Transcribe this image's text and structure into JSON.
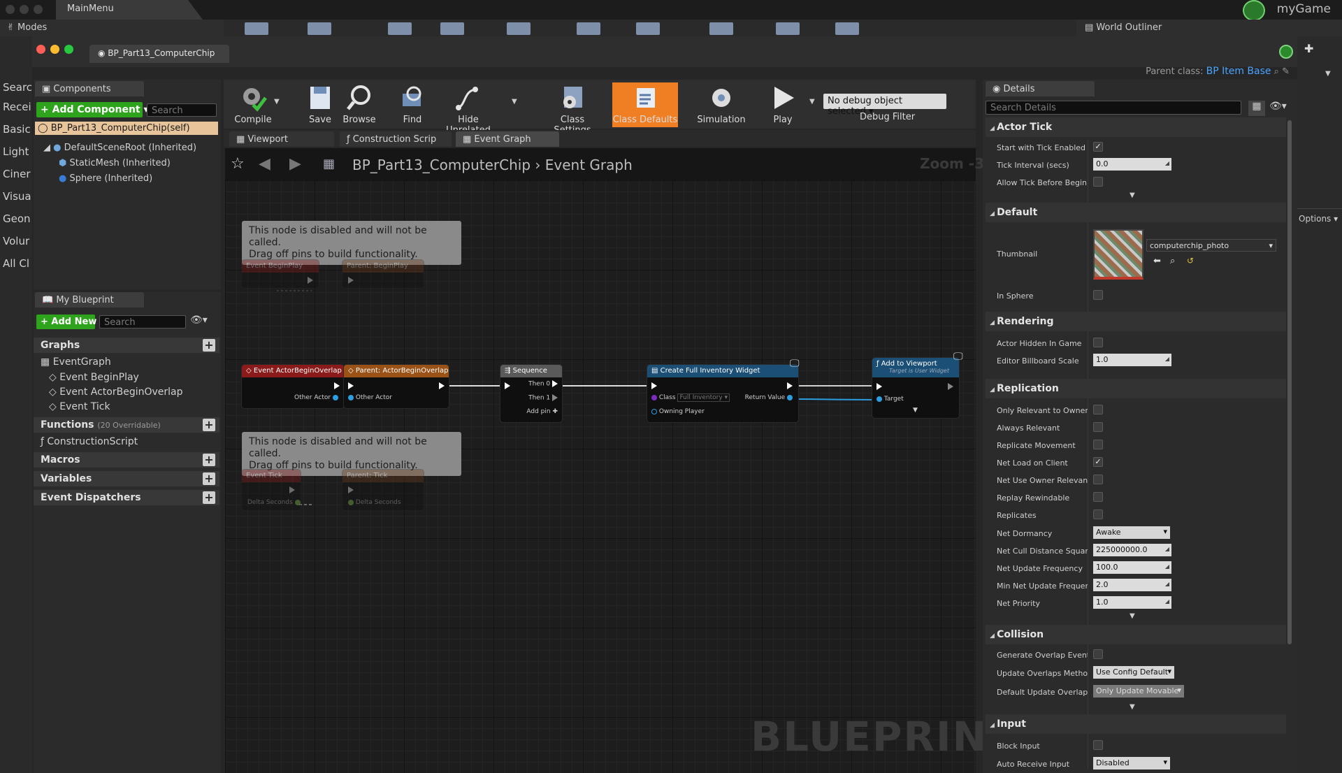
{
  "window": {
    "main_tab": "MainMenu",
    "app_name": "myGame",
    "modes_label": "Modes",
    "world_outliner": "World Outliner"
  },
  "left_strip": [
    "Searc",
    "Recei",
    "Basic",
    "Light",
    "Ciner",
    "Visua",
    "Geon",
    "Volur",
    "All Cl"
  ],
  "blueprint_tab": "BP_Part13_ComputerChip",
  "parent_class": {
    "label": "Parent class:",
    "value": "BP Item Base"
  },
  "components": {
    "tab": "Components",
    "add_label": "+ Add Component ▾",
    "search_placeholder": "Search",
    "items": [
      {
        "label": "BP_Part13_ComputerChip(self)",
        "selected": true
      },
      {
        "label": "DefaultSceneRoot (Inherited)"
      },
      {
        "label": "StaticMesh (Inherited)"
      },
      {
        "label": "Sphere (Inherited)"
      }
    ]
  },
  "my_blueprint": {
    "tab": "My Blueprint",
    "add_label": "+ Add New ▾",
    "search_placeholder": "Search",
    "graphs_label": "Graphs",
    "event_graph": "EventGraph",
    "events": [
      "Event BeginPlay",
      "Event ActorBeginOverlap",
      "Event Tick"
    ],
    "functions_label": "Functions",
    "functions_note": "(20 Overridable)",
    "construction_script": "ConstructionScript",
    "macros": "Macros",
    "variables": "Variables",
    "dispatchers": "Event Dispatchers"
  },
  "toolbar": {
    "buttons": [
      "Compile",
      "Save",
      "Browse",
      "Find",
      "Hide Unrelated",
      "Class Settings",
      "Class Defaults",
      "Simulation",
      "Play"
    ],
    "active": "Class Defaults",
    "debug_select": "No debug object selected ▾",
    "debug_filter": "Debug Filter"
  },
  "graph_tabs": [
    "Viewport",
    "Construction Scrip",
    "Event Graph"
  ],
  "graph": {
    "breadcrumb_bp": "BP_Part13_ComputerChip",
    "breadcrumb_sep": "›",
    "breadcrumb_graph": "Event Graph",
    "zoom": "Zoom -3",
    "watermark": "BLUEPRINT",
    "comment1": "This node is disabled and will not be called.\nDrag off pins to build functionality.",
    "comment2": "This node is disabled and will not be called.\nDrag off pins to build functionality.",
    "nodes": {
      "begin_play": "Event BeginPlay",
      "parent_begin_play": "Parent: BeginPlay",
      "overlap": "Event ActorBeginOverlap",
      "parent_overlap": "Parent: ActorBeginOverlap",
      "other_actor": "Other Actor",
      "other_actor2": "Other Actor",
      "sequence": "Sequence",
      "then0": "Then 0",
      "then1": "Then 1",
      "add_pin": "Add pin",
      "create_widget": "Create Full Inventory Widget",
      "class_pin": "Class",
      "class_val": "Full Inventory ▾",
      "return_value": "Return Value",
      "owning_player": "Owning Player",
      "add_viewport": "Add to Viewport",
      "add_viewport_sub": "Target is User Widget",
      "target": "Target",
      "event_tick": "Event Tick",
      "parent_tick": "Parent: Tick",
      "delta1": "Delta Seconds",
      "delta2": "Delta Seconds"
    }
  },
  "details": {
    "tab": "Details",
    "search_placeholder": "Search Details",
    "sections": {
      "actor_tick": "Actor Tick",
      "default": "Default",
      "rendering": "Rendering",
      "replication": "Replication",
      "collision": "Collision",
      "input": "Input"
    },
    "rows": {
      "start_tick": "Start with Tick Enabled",
      "tick_interval": "Tick Interval (secs)",
      "tick_interval_val": "0.0",
      "allow_tick": "Allow Tick Before Begin Pl",
      "thumbnail": "Thumbnail",
      "thumbnail_asset": "computerchip_photo",
      "in_sphere": "In Sphere",
      "hidden": "Actor Hidden In Game",
      "billboard": "Editor Billboard Scale",
      "billboard_val": "1.0",
      "only_owner": "Only Relevant to Owner",
      "always_rel": "Always Relevant",
      "rep_move": "Replicate Movement",
      "net_load": "Net Load on Client",
      "net_owner": "Net Use Owner Relevancy",
      "replay": "Replay Rewindable",
      "replicates": "Replicates",
      "dormancy": "Net Dormancy",
      "dormancy_val": "Awake",
      "cull": "Net Cull Distance Squared",
      "cull_val": "225000000.0",
      "update_freq": "Net Update Frequency",
      "update_freq_val": "100.0",
      "min_freq": "Min Net Update Frequency",
      "min_freq_val": "2.0",
      "priority": "Net Priority",
      "priority_val": "1.0",
      "gen_overlap": "Generate Overlap Events D",
      "upd_method": "Update Overlaps Method D",
      "upd_method_val": "Use Config Default",
      "def_upd": "Default Update Overlaps M",
      "def_upd_val": "Only Update Movable",
      "block_input": "Block Input",
      "auto_input": "Auto Receive Input",
      "auto_input_val": "Disabled"
    }
  },
  "options_label": "Options ▾"
}
